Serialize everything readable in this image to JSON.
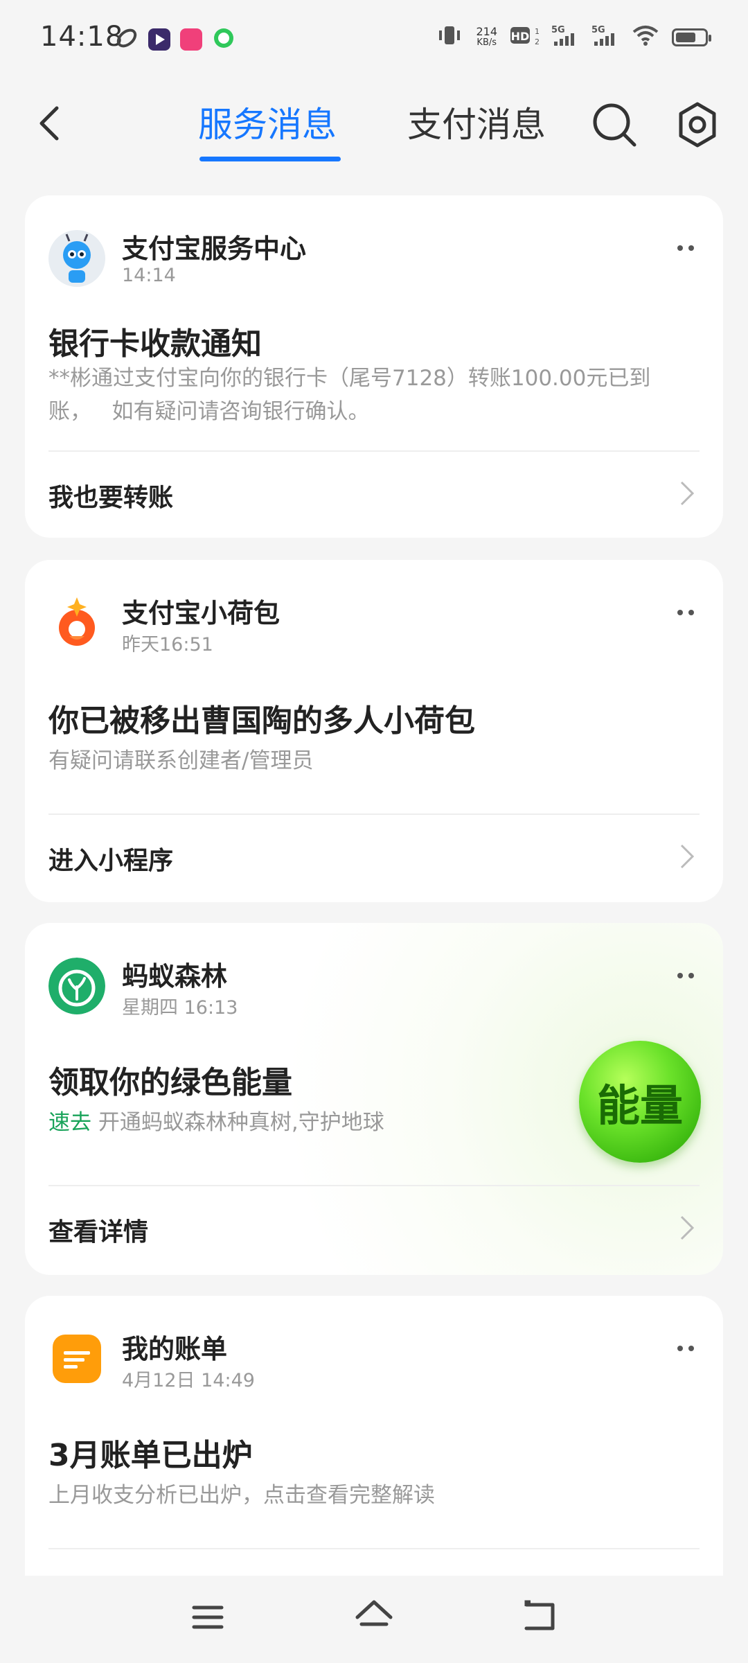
{
  "status_bar": {
    "time": "14:18",
    "net_speed_top": "214",
    "net_speed_bottom": "KB/s"
  },
  "header": {
    "tabs": [
      {
        "label": "服务消息",
        "active": true
      },
      {
        "label": "支付消息",
        "active": false
      }
    ],
    "accent_color": "#1677ff",
    "icons": [
      "back-icon",
      "search-icon",
      "gear-icon"
    ]
  },
  "cards": [
    {
      "sender": "支付宝服务中心",
      "time": "14:14",
      "title": "银行卡收款通知",
      "desc_line1": "**彬通过支付宝向你的银行卡（尾号7128）转账100.00元已到",
      "desc_line2": "账，   如有疑问请咨询银行确认。",
      "action": "我也要转账"
    },
    {
      "sender": "支付宝小荷包",
      "time": "昨天16:51",
      "title": "你已被移出曹国陶的多人小荷包",
      "desc": "有疑问请联系创建者/管理员",
      "action": "进入小程序"
    },
    {
      "sender": "蚂蚁森林",
      "time": "星期四 16:13",
      "title": "领取你的绿色能量",
      "desc_accent": "速去",
      "desc": " 开通蚂蚁森林种真树,守护地球",
      "badge": "能量",
      "action": "查看详情"
    },
    {
      "sender": "我的账单",
      "time": "4月12日 14:49",
      "title": "3月账单已出炉",
      "desc": "上月收支分析已出炉，点击查看完整解读"
    }
  ],
  "bottom_nav": [
    "menu-icon",
    "home-icon",
    "back-nav-icon"
  ]
}
